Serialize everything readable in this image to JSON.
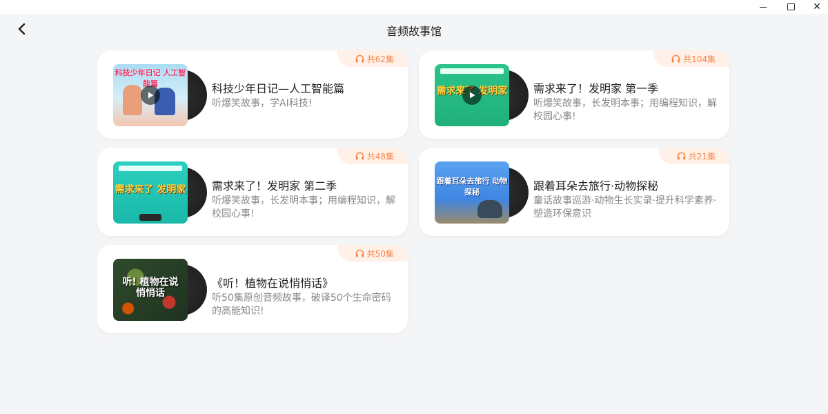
{
  "window": {
    "close_symbol": "✕"
  },
  "header": {
    "title": "音频故事馆"
  },
  "stories": [
    {
      "title": "科技少年日记—人工智能篇",
      "desc": "听爆笑故事，学AI科技!",
      "count": "共62集",
      "cover_color": "#bfe6f5",
      "cover_text": "科技少年日记 人工智能篇",
      "show_play": true
    },
    {
      "title": "需求来了！发明家 第一季",
      "desc": "听爆笑故事，长发明本事；用编程知识，解校园心事!",
      "count": "共104集",
      "cover_color": "#2bc48a",
      "cover_text": "需求来了 发明家",
      "show_play": true
    },
    {
      "title": "需求来了！发明家 第二季",
      "desc": "听爆笑故事，长发明本事；用编程知识，解校园心事!",
      "count": "共48集",
      "cover_color": "#22c7b8",
      "cover_text": "需求来了 发明家",
      "show_play": false
    },
    {
      "title": "跟着耳朵去旅行·动物探秘",
      "desc": "童话故事巡游·动物生长实录·提升科学素养·塑造环保意识",
      "count": "共21集",
      "cover_color": "#3f86e3",
      "cover_text": "跟着耳朵去旅行 动物探秘",
      "show_play": false
    },
    {
      "title": "《听！植物在说悄悄话》",
      "desc": "听50集原创音频故事，破译50个生命密码的高能知识!",
      "count": "共50集",
      "cover_color": "#2f4a2c",
      "cover_text": "听! 植物在说 悄悄话",
      "show_play": false
    }
  ]
}
